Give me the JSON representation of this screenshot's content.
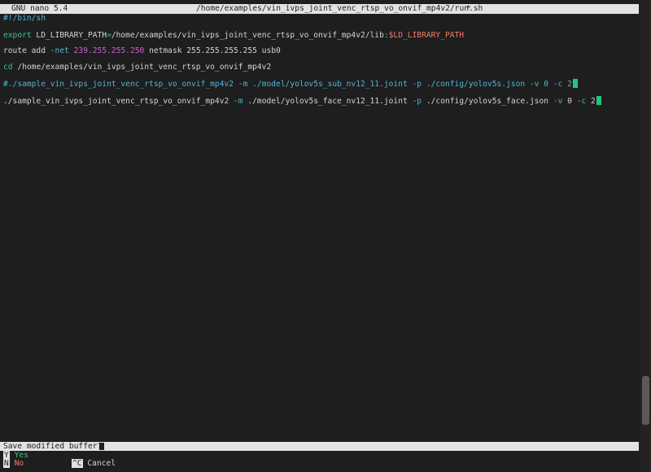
{
  "titlebar": {
    "app": "GNU nano 5.4",
    "path": "/home/examples/vin_ivps_joint_venc_rtsp_vo_onvif_mp4v2/run.sh",
    "modified": "*"
  },
  "editor": {
    "shebang": "#!/bin/sh",
    "export_keyword": "export",
    "export_name": " LD_LIBRARY_PATH",
    "export_eq": "=",
    "export_value": "/home/examples/vin_ivps_joint_venc_rtsp_vo_onvif_mp4v2/lib",
    "export_colon": ":",
    "export_var": "$LD_LIBRARY_PATH",
    "route_cmd": "route add ",
    "route_flag": "-net",
    "route_ip": " 239.255.255.250",
    "route_rest": " netmask 255.255.255.255 usb0",
    "cd_keyword": "cd",
    "cd_path": " /home/examples/vin_ivps_joint_venc_rtsp_vo_onvif_mp4v2",
    "comment_line": "#./sample_vin_ivps_joint_venc_rtsp_vo_onvif_mp4v2 -m ./model/yolov5s_sub_nv12_11.joint -p ./config/yolov5s.json -v 0 -c 2",
    "run_cmd": "./sample_vin_ivps_joint_venc_rtsp_vo_onvif_mp4v2 ",
    "run_flag_m": "-m",
    "run_model": " ./model/yolov5s_face_nv12_11.joint ",
    "run_flag_p": "-p",
    "run_config": " ./config/yolov5s_face.json ",
    "run_flag_v": "-v",
    "run_v_val": " 0 ",
    "run_flag_c": "-c",
    "run_c_val": " 2"
  },
  "prompt": {
    "question": "Save modified buffer?"
  },
  "shortcuts": {
    "yes_key": "Y",
    "yes_label": "Yes",
    "no_key": "N",
    "no_label": "No",
    "cancel_key": "^C",
    "cancel_label": "Cancel"
  },
  "colors": {
    "background": "#1e1e1e",
    "bar": "#e2e2e2",
    "comment": "#4fb4d8",
    "keyword": "#3fc08a",
    "number": "#d15cd9",
    "variable": "#f07c6a",
    "cursor": "#24c57f"
  }
}
